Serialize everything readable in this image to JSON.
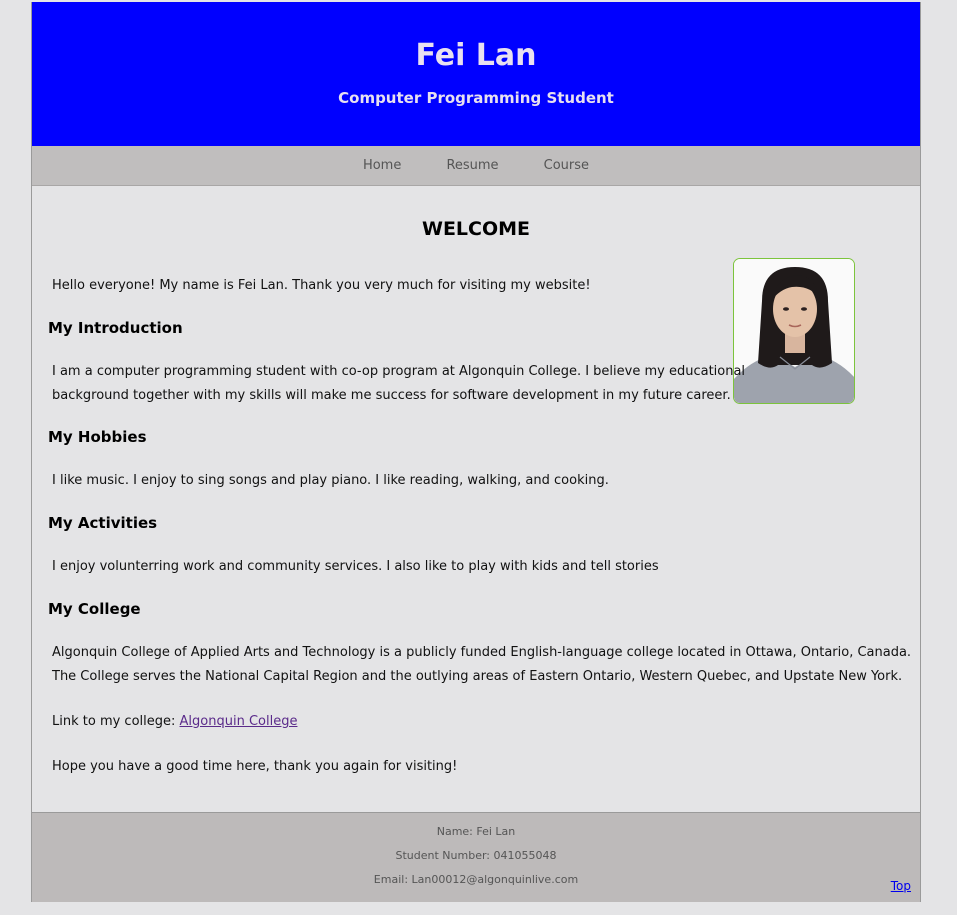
{
  "header": {
    "name": "Fei Lan",
    "subtitle": "Computer Programming Student"
  },
  "nav": {
    "items": [
      "Home",
      "Resume",
      "Course"
    ]
  },
  "main": {
    "welcome": "WELCOME",
    "greeting": "Hello everyone! My name is Fei Lan. Thank you very much for visiting my website!",
    "intro_heading": "My Introduction",
    "intro_line1": "I am a computer programming student with co-op program at Algonquin College. I believe my educational",
    "intro_line2": "background together with my skills will make me success for software development in my future career.",
    "hobbies_heading": "My Hobbies",
    "hobbies_text": "I like music. I enjoy to sing songs and play piano. I like reading, walking, and cooking.",
    "activities_heading": "My Activities",
    "activities_text": "I enjoy volunterring work and community services. I also like to play with kids and tell stories",
    "college_heading": "My College",
    "college_line1": "Algonquin College of Applied Arts and Technology is a publicly funded English-language college located in Ottawa, Ontario, Canada.",
    "college_line2": "The College serves the National Capital Region and the outlying areas of Eastern Ontario, Western Quebec, and Upstate New York.",
    "link_prefix": "Link to my college: ",
    "link_text": "Algonquin College",
    "closing": "Hope you have a good time here, thank you again for visiting!"
  },
  "footer": {
    "name_line": "Name: Fei Lan",
    "student_number_line": "Student Number: 041055048",
    "email_line": "Email: Lan00012@algonquinlive.com",
    "top_link": "Top"
  },
  "colors": {
    "header_bg": "#0000ff",
    "nav_bg": "#c0bebe",
    "page_bg": "#e4e4e6",
    "footer_bg": "#bdbaba",
    "photo_border": "#7cc43c"
  }
}
